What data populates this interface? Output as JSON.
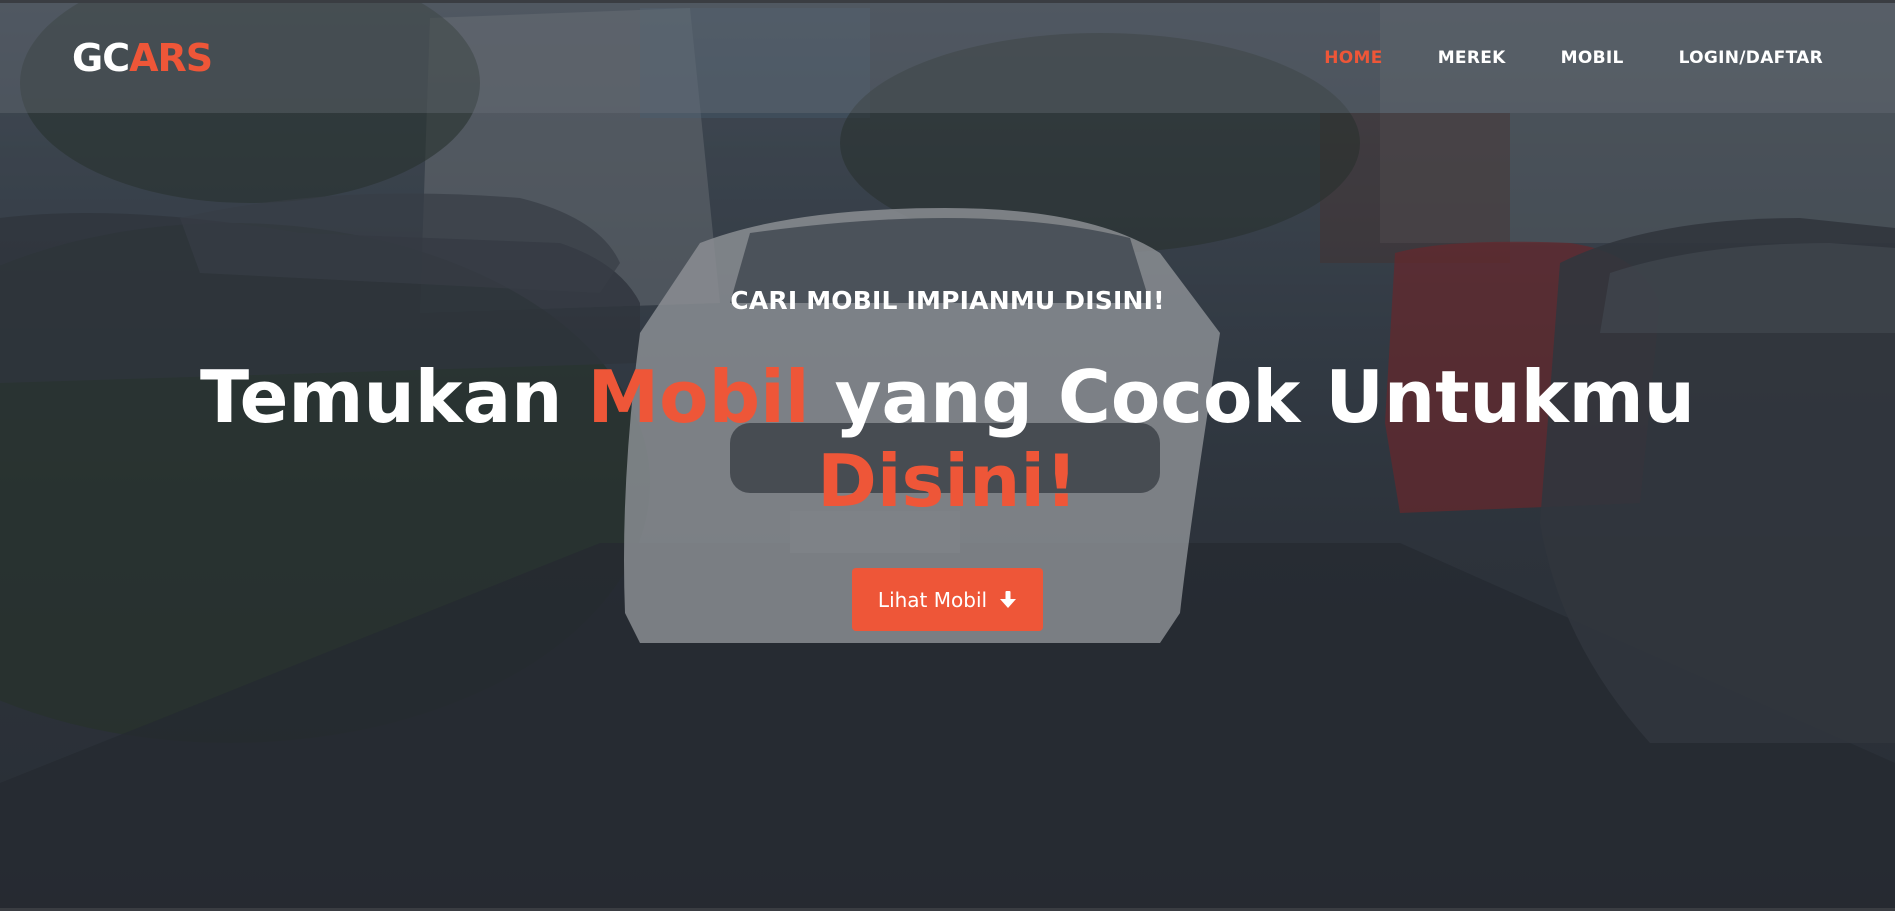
{
  "header": {
    "logo": {
      "part1": "GC",
      "part2": "ARS"
    },
    "nav": [
      {
        "label": "HOME",
        "active": true
      },
      {
        "label": "MEREK",
        "active": false
      },
      {
        "label": "MOBIL",
        "active": false
      },
      {
        "label": "LOGIN/DAFTAR",
        "active": false
      }
    ]
  },
  "hero": {
    "subtitle": "CARI MOBIL IMPIANMU DISINI!",
    "title": {
      "part1": "Temukan ",
      "accent1": "Mobil",
      "part2": " yang Cocok Untukmu",
      "accent2": "Disini!"
    },
    "cta": {
      "label": "Lihat Mobil",
      "icon": "arrow-down-icon"
    }
  },
  "colors": {
    "accent": "#ee5638",
    "text": "#ffffff"
  }
}
